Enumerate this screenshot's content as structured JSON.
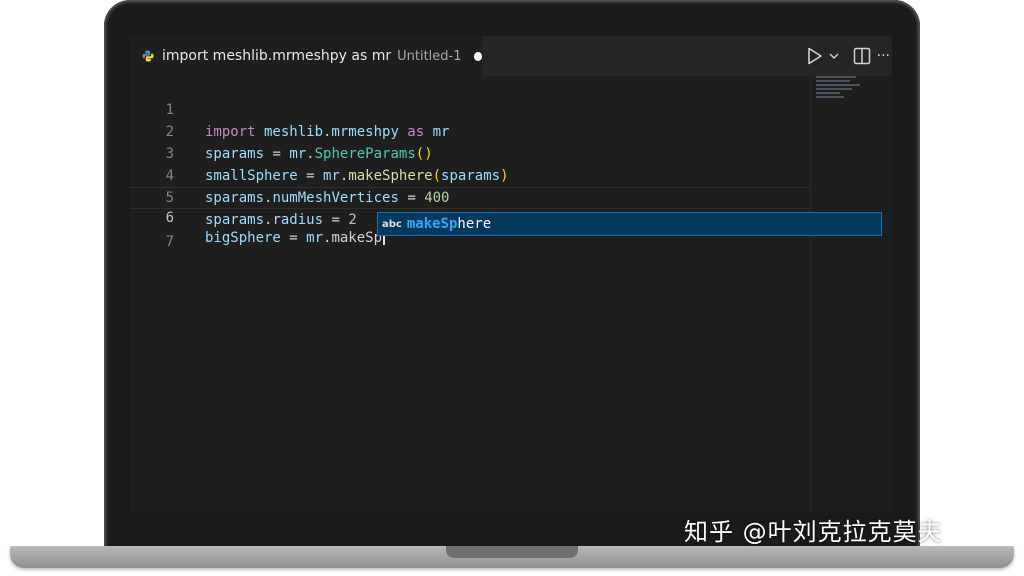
{
  "editor_tab": {
    "title": "import meshlib.mrmeshpy as mr",
    "subtitle": "Untitled-1",
    "file_icon": "python-icon",
    "modified_indicator": "unsaved-dot"
  },
  "toolbar": {
    "run_icon": "play-icon",
    "run_dropdown_icon": "chevron-down-icon",
    "split_icon": "split-editor-icon",
    "more_icon": "ellipsis-icon",
    "more_label": "···"
  },
  "code_lines": [
    {
      "number": "1",
      "text": "import meshlib.mrmeshpy as mr"
    },
    {
      "number": "2",
      "text": "sparams = mr.SphereParams()"
    },
    {
      "number": "3",
      "text": "smallSphere = mr.makeSphere(sparams)"
    },
    {
      "number": "4",
      "text": "sparams.numMeshVertices = 400"
    },
    {
      "number": "5",
      "text": "sparams.radius = 2"
    },
    {
      "number": "6",
      "text": "bigSphere = mr.makeSp"
    },
    {
      "number": "7",
      "text": ""
    }
  ],
  "tokens": {
    "l1": {
      "kw1": "import",
      "mod": " meshlib.mrmeshpy ",
      "kw2": "as",
      "alias": " mr"
    },
    "l2": {
      "var": "sparams",
      "op": " = ",
      "mod": "mr",
      "dot": ".",
      "cls": "SphereParams",
      "paren": "()"
    },
    "l3": {
      "var": "smallSphere",
      "op": " = ",
      "mod": "mr",
      "dot": ".",
      "fn": "makeSphere",
      "po": "(",
      "arg": "sparams",
      "pc": ")"
    },
    "l4": {
      "var": "sparams",
      "dot": ".",
      "attr": "numMeshVertices",
      "op": " = ",
      "num": "400"
    },
    "l5": {
      "var": "sparams",
      "dot": ".",
      "attr": "radius",
      "op": " = ",
      "num": "2"
    },
    "l6": {
      "var": "bigSphere",
      "op": " = ",
      "mod": "mr",
      "dot": ".",
      "partial": "makeSp"
    }
  },
  "current_line": 6,
  "suggestion": {
    "kind_icon": "abc",
    "match": "makeSp",
    "rest": "here"
  },
  "watermark": "知乎 @叶刘克拉克莫夫",
  "colors": {
    "editor_background": "#1e1e1e",
    "keyword": "#c586c0",
    "variable": "#9cdcfe",
    "class": "#4ec9b0",
    "function": "#dcdcaa",
    "number": "#b5cea8",
    "bracket": "#ffd700",
    "suggest_selected": "#04395e",
    "suggest_match": "#2aaaff"
  }
}
